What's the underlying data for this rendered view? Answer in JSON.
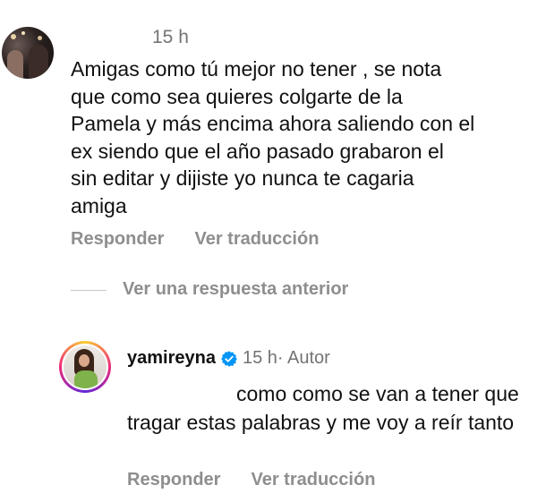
{
  "comment": {
    "timestamp": "15 h",
    "text": "Amigas como tú mejor no tener , se nota\nque como sea quieres colgarte de la\nPamela y más encima ahora saliendo con el\nex  siendo que el año pasado grabaron el\nsin editar y dijiste yo nunca te cagaria\namiga",
    "reply_label": "Responder",
    "translate_label": "Ver traducción"
  },
  "view_previous_label": "Ver una respuesta anterior",
  "reply": {
    "username": "yamireyna",
    "verified_icon": "verified-badge-icon",
    "verified_color": "#0095f6",
    "timestamp": "15 h",
    "author_tag": " · Autor",
    "text": "como como se van a tener que tragar estas palabras y me voy a reír tanto",
    "reply_label": "Responder",
    "translate_label": "Ver traducción"
  }
}
